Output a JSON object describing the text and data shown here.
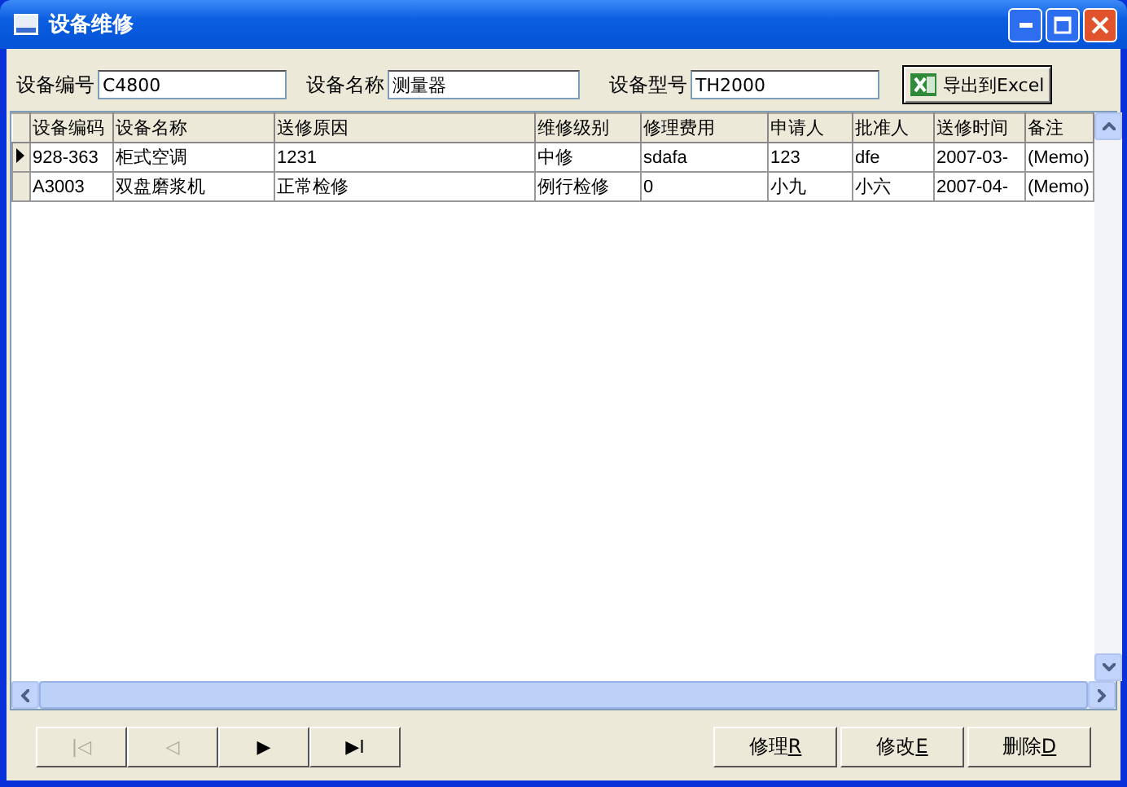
{
  "window": {
    "title": "设备维修"
  },
  "filters": [
    {
      "label": "设备编号",
      "value": "C4800"
    },
    {
      "label": "设备名称",
      "value": "测量器"
    },
    {
      "label": "设备型号",
      "value": "TH2000"
    }
  ],
  "export_button": {
    "label": "导出到Excel"
  },
  "table": {
    "columns": [
      "设备编码",
      "设备名称",
      "送修原因",
      "维修级别",
      "修理费用",
      "申请人",
      "批准人",
      "送修时间",
      "备注"
    ],
    "rows": [
      {
        "current": true,
        "cells": [
          "928-363",
          "柜式空调",
          "1231",
          "中修",
          "sdafa",
          "123",
          "dfe",
          "2007-03-",
          "(Memo)"
        ]
      },
      {
        "current": false,
        "cells": [
          "A3003",
          "双盘磨浆机",
          "正常检修",
          "例行检修",
          "0",
          "小九",
          "小六",
          "2007-04-",
          "(Memo)"
        ]
      }
    ]
  },
  "navigator": [
    {
      "label": "|◁",
      "disabled": true
    },
    {
      "label": "◁",
      "disabled": true
    },
    {
      "label": "▶",
      "disabled": false
    },
    {
      "label": "▶I",
      "disabled": false
    }
  ],
  "actions": [
    {
      "label": "修理",
      "accel": "R"
    },
    {
      "label": "修改",
      "accel": "E"
    },
    {
      "label": "删除",
      "accel": "D"
    }
  ]
}
